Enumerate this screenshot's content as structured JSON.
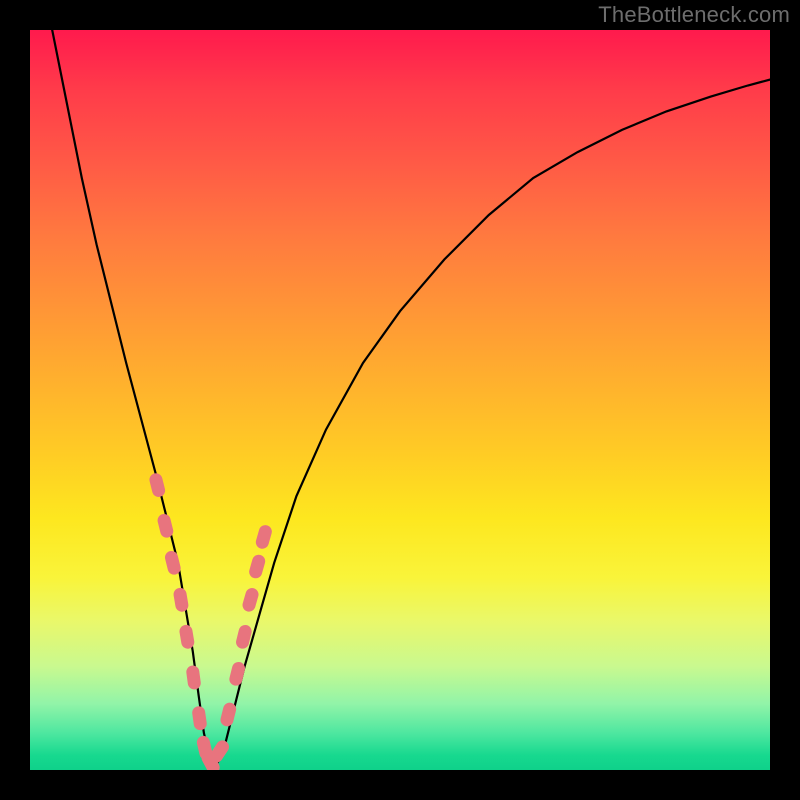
{
  "watermark": "TheBottleneck.com",
  "colors": {
    "frame": "#000000",
    "curve": "#000000",
    "marker_fill": "#e8747e",
    "marker_stroke": "#d2626d",
    "gradient_top": "#ff1a4d",
    "gradient_bottom": "#0fd18a"
  },
  "chart_data": {
    "type": "line",
    "title": "",
    "xlabel": "",
    "ylabel": "",
    "xlim": [
      0,
      100
    ],
    "ylim": [
      0,
      100
    ],
    "grid": false,
    "legend": false,
    "series": [
      {
        "name": "bottleneck-curve",
        "x": [
          3,
          5,
          7,
          9,
          11,
          13,
          15,
          17,
          18.5,
          20,
          21,
          22,
          22.8,
          23.5,
          24.2,
          25,
          26,
          27.5,
          29,
          31,
          33,
          36,
          40,
          45,
          50,
          56,
          62,
          68,
          74,
          80,
          86,
          92,
          97,
          100
        ],
        "y": [
          100,
          90,
          80,
          71,
          63,
          55,
          47.5,
          40,
          34,
          28,
          22,
          16,
          10,
          5,
          2,
          0.5,
          2,
          8,
          14,
          21,
          28,
          37,
          46,
          55,
          62,
          69,
          75,
          80,
          83.5,
          86.5,
          89,
          91,
          92.5,
          93.3
        ]
      }
    ],
    "markers": {
      "name": "highlighted-points",
      "shape": "rounded-bar",
      "x": [
        17.2,
        18.3,
        19.3,
        20.4,
        21.2,
        22.1,
        22.9,
        23.6,
        24.4,
        25.6,
        26.8,
        28.0,
        28.9,
        29.8,
        30.7,
        31.6
      ],
      "y": [
        38.5,
        33.0,
        28.0,
        23.0,
        18.0,
        12.5,
        7.0,
        3.0,
        1.0,
        2.5,
        7.5,
        13.0,
        18.0,
        23.0,
        27.5,
        31.5
      ]
    }
  }
}
